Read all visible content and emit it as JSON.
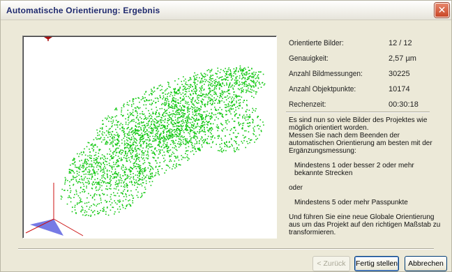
{
  "window": {
    "title": "Automatische Orientierung: Ergebnis"
  },
  "stats": [
    {
      "label": "Orientierte Bilder:",
      "value": "12 / 12"
    },
    {
      "label": "Genauigkeit:",
      "value": "2,57 µm"
    },
    {
      "label": "Anzahl Bildmessungen:",
      "value": "30225"
    },
    {
      "label": "Anzahl Objektpunkte:",
      "value": "10174"
    },
    {
      "label": "Rechenzeit:",
      "value": "00:30:18"
    }
  ],
  "message": {
    "intro": "Es sind nun so viele Bilder des Projektes wie möglich orientiert worden.",
    "advice": "Messen Sie nach dem Beenden der automatischen Orientierung am besten mit der Ergänzungsmessung:",
    "option1": "Mindestens 1 oder besser 2 oder mehr bekannte Strecken",
    "or": "oder",
    "option2": "Mindestens 5 oder mehr Passpunkte",
    "outro": "Und führen Sie eine neue Globale Orientierung aus um das Projekt auf den richtigen Maßstab zu transformieren."
  },
  "buttons": {
    "back": "< Zurück",
    "finish": "Fertig stellen",
    "cancel": "Abbrechen"
  },
  "colors": {
    "points": "#13c813",
    "axis": "#cc1111",
    "cone": "#6f73e4"
  }
}
